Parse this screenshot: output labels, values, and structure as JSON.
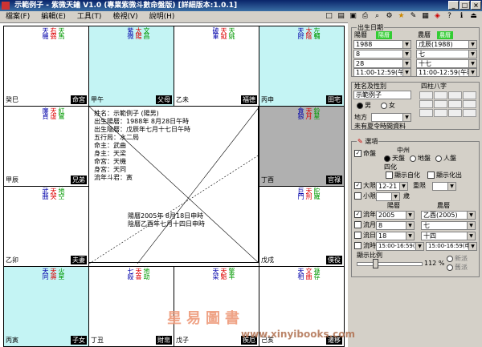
{
  "window": {
    "title": "示範例子 - 紫微天鑰 V1.0 (專業紫微斗數命盤版) [詳細版本:1.0.1]",
    "controls": [
      "_",
      "□",
      "×"
    ]
  },
  "menu": [
    "檔案(F)",
    "編輯(E)",
    "工具(T)",
    "檢視(V)",
    "說明(H)"
  ],
  "toolbar_icons": [
    "new-icon",
    "open-icon",
    "save-icon",
    "print-icon",
    "zoom-icon",
    "settings-icon",
    "star-icon",
    "edit-icon",
    "chart-icon",
    "palette-icon",
    "help-icon",
    "info-icon",
    "exit-icon"
  ],
  "palaces": [
    {
      "id": "tl",
      "name": "命宮",
      "ganzhi": "癸巳",
      "stars": [
        "天機",
        "右弼"
      ],
      "minor": [
        "天馬"
      ],
      "hl": "none"
    },
    {
      "id": "t2",
      "name": "父母",
      "ganzhi": "甲午",
      "stars": [
        "紫微",
        "太陽"
      ],
      "minor": [
        "文昌"
      ],
      "hl": "cyan"
    },
    {
      "id": "t3",
      "name": "福德",
      "ganzhi": "乙未",
      "stars": [
        "破軍",
        "天鉞"
      ],
      "minor": [
        "天姚"
      ],
      "hl": "none"
    },
    {
      "id": "tr",
      "name": "田宅",
      "ganzhi": "丙申",
      "stars": [
        "天府",
        "太陰"
      ],
      "minor": [
        "左輔"
      ],
      "hl": "cyan"
    },
    {
      "id": "r2",
      "name": "官祿",
      "ganzhi": "丁酉",
      "stars": [
        "貪狼",
        "天月"
      ],
      "minor": [
        "鈴星"
      ],
      "hl": "gray"
    },
    {
      "id": "r3",
      "name": "僕役",
      "ganzhi": "戊戌",
      "stars": [
        "巨門",
        "天刑"
      ],
      "minor": [
        "陀羅"
      ],
      "hl": "none"
    },
    {
      "id": "br",
      "name": "遷移",
      "ganzhi": "己亥",
      "stars": [
        "天相",
        "文曲"
      ],
      "minor": [
        "祿存"
      ],
      "hl": "none"
    },
    {
      "id": "b3",
      "name": "疾厄",
      "ganzhi": "戊子",
      "stars": [
        "天梁",
        "天魁"
      ],
      "minor": [
        "擎羊"
      ],
      "hl": "none"
    },
    {
      "id": "b2",
      "name": "財帛",
      "ganzhi": "丁丑",
      "stars": [
        "七殺",
        "天喜"
      ],
      "minor": [
        "地劫"
      ],
      "hl": "none"
    },
    {
      "id": "bl",
      "name": "子女",
      "ganzhi": "丙寅",
      "stars": [
        "天同",
        "天壽"
      ],
      "minor": [
        "火星"
      ],
      "hl": "cyan"
    },
    {
      "id": "l3",
      "name": "夫妻",
      "ganzhi": "乙卯",
      "stars": [
        "武曲",
        "天哭"
      ],
      "minor": [
        "地空"
      ],
      "hl": "none"
    },
    {
      "id": "l2",
      "name": "兄弟",
      "ganzhi": "甲辰",
      "stars": [
        "廉貞",
        "天虛"
      ],
      "minor": [
        "紅鸞"
      ],
      "hl": "none"
    }
  ],
  "center": {
    "lines": [
      "姓名：示範例子 (陽男)",
      "出生陽曆：1988年 8月28日午時",
      "出生陰曆：戊辰年七月十七日午時",
      "五行局：水二局",
      "命主：武曲",
      "身主：天梁",
      "命宮：天機",
      "身宮：天同",
      "流年斗君：寅"
    ],
    "date_lines": [
      "陽曆2005年 8月18日申時",
      "陰曆乙酉年七月十四日申時"
    ]
  },
  "outer_labels": [
    "命宮",
    "兄弟",
    "夫妻",
    "子女",
    "財帛",
    "疾厄",
    "遷移",
    "僕役",
    "官祿",
    "田宅",
    "福德",
    "父母"
  ],
  "birth": {
    "title": "出生日期",
    "solar_label": "陽曆",
    "lunar_label": "農曆",
    "year_solar": "1988",
    "year_lunar": "戊辰(1988)",
    "month_solar": "8",
    "month_lunar": "七",
    "day_solar": "28",
    "day_lunar": "十七",
    "hour_solar": "11:00-12:59(午時)",
    "hour_lunar": "11:00-12:59(午時)"
  },
  "person": {
    "name_label": "姓名及性別",
    "name_value": "示範例子",
    "male": "男",
    "female": "女",
    "place_label": "地方",
    "bazi_label": "四柱八字",
    "dst_label": "未有夏令時間資料"
  },
  "options": {
    "title": "選項",
    "chart_check": "命盤",
    "middle_label": "中州",
    "tianpan": "天盤",
    "dipan": "地盤",
    "renpan": "人盤",
    "sihua_label": "四化",
    "show_ziha": "顯示自化",
    "show_sihua_out": "顯示化出",
    "daxian_label": "大限",
    "daxian_value": "12-21",
    "chongxian": "重限",
    "xiaoxian_label": "小限",
    "sui_label": "歲",
    "solar_label": "陽曆",
    "lunar_label": "農曆",
    "liunian_label": "流年",
    "liunian_solar": "2005",
    "liunian_lunar": "乙酉(2005)",
    "liuyue_label": "流月",
    "liuyue_solar": "8",
    "liuyue_lunar": "七",
    "liuri_label": "流日",
    "liuri_solar": "18",
    "liuri_lunar": "十四",
    "liushi_label": "流時",
    "liushi_solar": "15:00-16:59(申時)",
    "liushi_lunar": "15:00-16:59(申時)",
    "scale_label": "顯示比例",
    "scale_value": "112 %",
    "new_school": "新派",
    "old_school": "舊派",
    "green_btn": "陽曆"
  },
  "watermark": {
    "text": "星易圖書",
    "url": "www.xinyibooks.com"
  },
  "colors": {
    "title_bar": "#0a246a",
    "highlight_cyan": "#c4f4f4",
    "highlight_gray": "#b0b0b0",
    "star_red": "#d00",
    "star_blue": "#00a",
    "star_green": "#090"
  }
}
